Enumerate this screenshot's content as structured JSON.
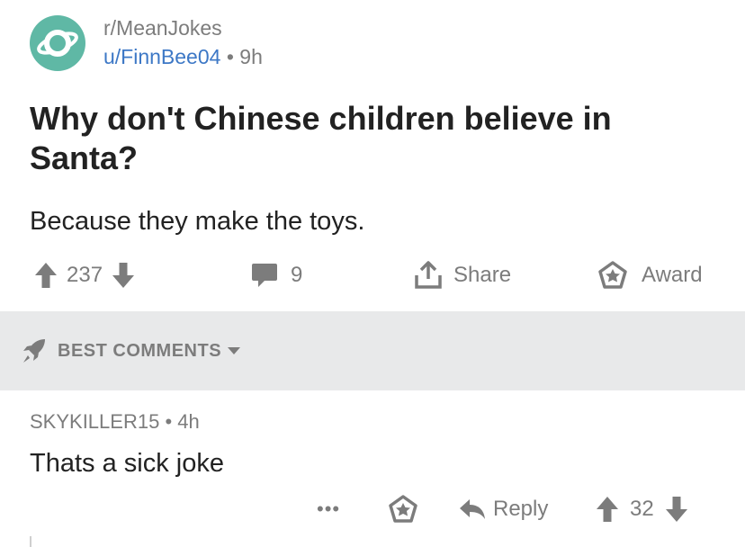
{
  "post": {
    "subreddit": "r/MeanJokes",
    "author": "u/FinnBee04",
    "separator": "•",
    "age": "9h",
    "title": "Why don't Chinese children believe in Santa?",
    "body": "Because they make the toys.",
    "score": "237",
    "comment_count": "9",
    "share_label": "Share",
    "award_label": "Award"
  },
  "sort": {
    "label": "BEST COMMENTS"
  },
  "comment": {
    "author": "SKYKILLER15",
    "separator": "•",
    "age": "4h",
    "body": "Thats a sick joke",
    "more_label": "•••",
    "reply_label": "Reply",
    "score": "32"
  },
  "colors": {
    "avatar_bg": "#5fb8a5",
    "username": "#3d78c6",
    "muted": "#7c7c7c",
    "sort_bar_bg": "#e8e9ea"
  },
  "icons": [
    "planet-icon",
    "upvote-arrow-icon",
    "downvote-arrow-icon",
    "comment-bubble-icon",
    "share-icon",
    "award-icon",
    "rocket-icon",
    "caret-down-icon",
    "reply-arrow-icon"
  ]
}
